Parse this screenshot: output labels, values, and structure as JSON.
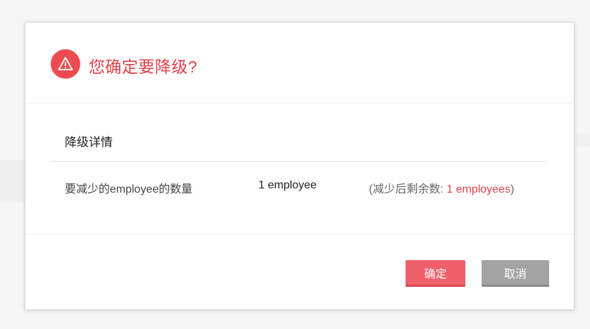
{
  "dialog": {
    "title": "您确定要降级?",
    "icon": "warning-icon",
    "section_title": "降级详情",
    "row": {
      "label": "要减少的employee的数量",
      "value": "1 employee",
      "remaining_prefix": "(减少后剩余数: ",
      "remaining_value": "1 employees",
      "remaining_suffix": ")"
    },
    "buttons": {
      "confirm": "确定",
      "cancel": "取消"
    }
  },
  "colors": {
    "accent": "#e0404a",
    "confirm_button": "#f0606a",
    "cancel_button": "#a3a3a3"
  }
}
